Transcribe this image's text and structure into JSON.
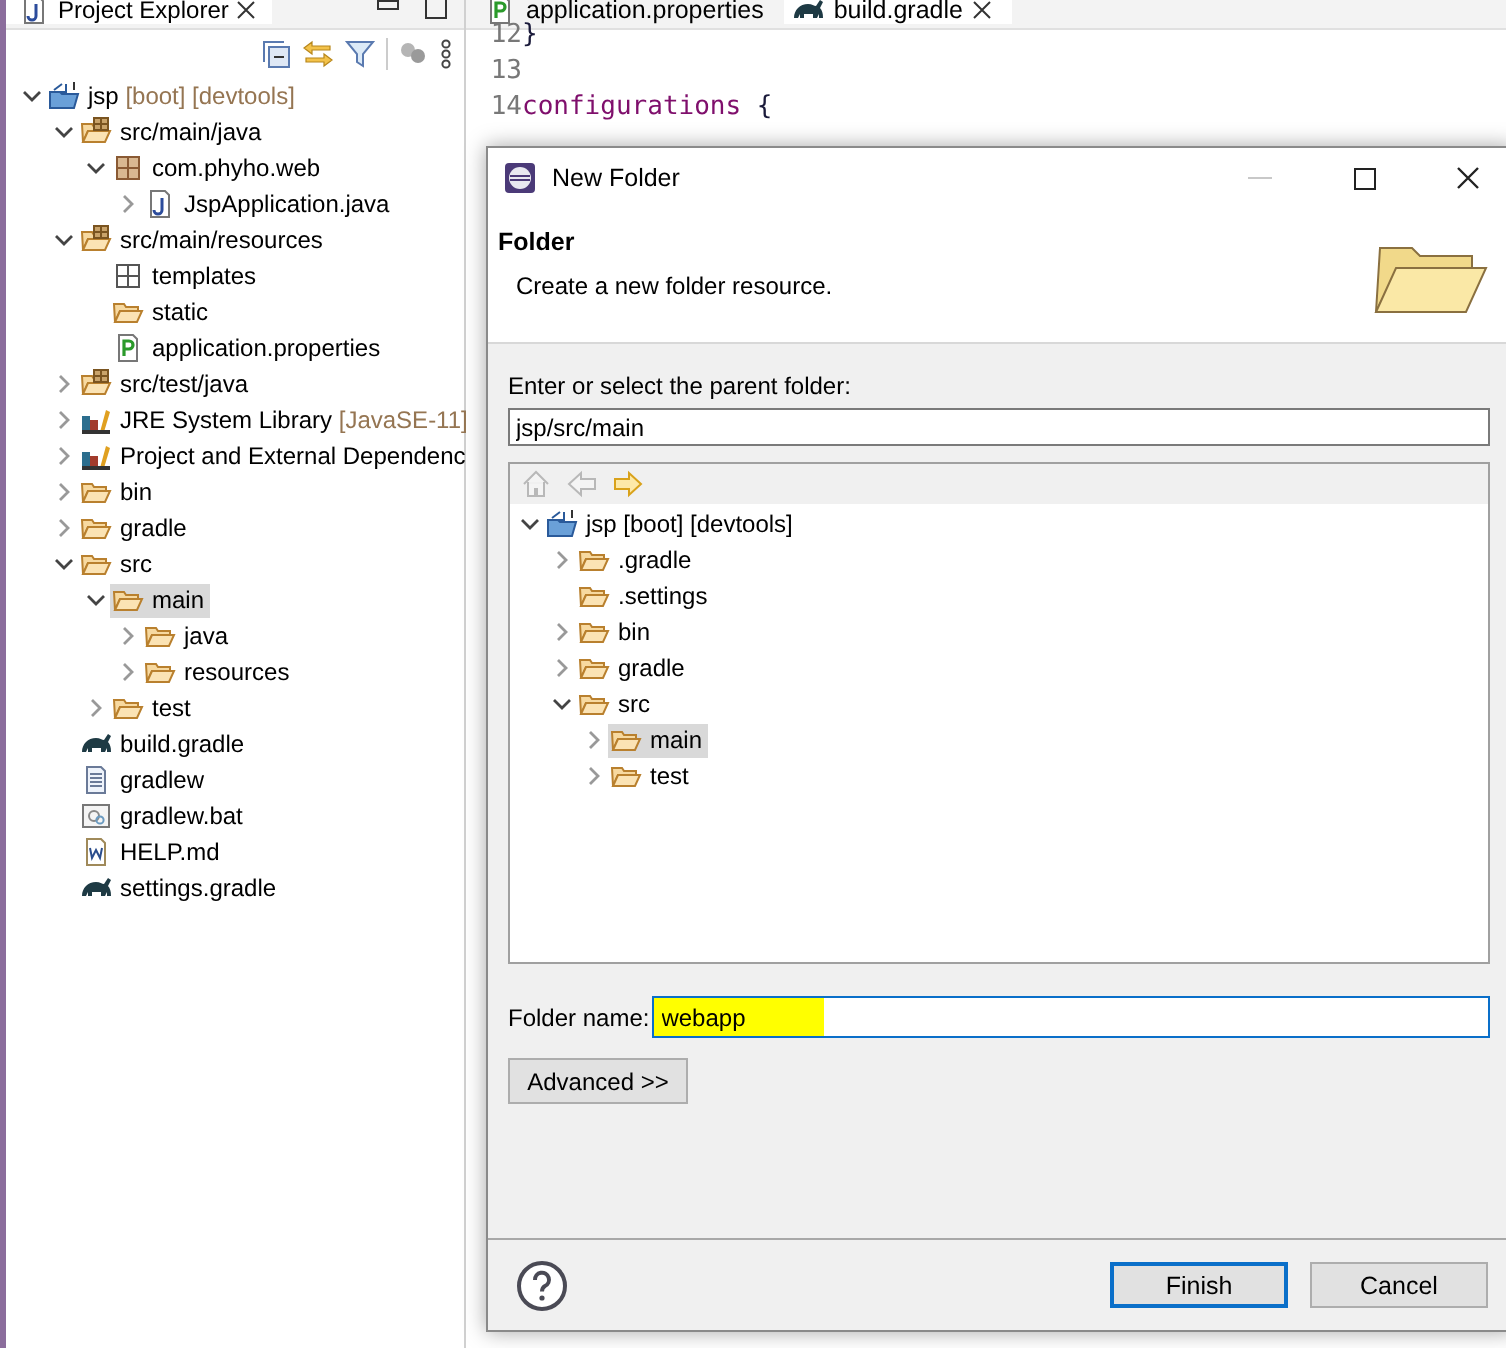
{
  "explorer": {
    "title": "Project Explorer",
    "tree": [
      {
        "label": "jsp",
        "decoration": "[boot] [devtools]",
        "kind": "project",
        "expanded": true,
        "selected": false,
        "children": [
          {
            "label": "src/main/java",
            "kind": "source-folder",
            "expanded": true,
            "selected": false,
            "children": [
              {
                "label": "com.phyho.web",
                "kind": "package",
                "expanded": true,
                "selected": false,
                "children": [
                  {
                    "label": "JspApplication.java",
                    "kind": "java-file",
                    "expanded": false,
                    "selected": false
                  }
                ]
              }
            ]
          },
          {
            "label": "src/main/resources",
            "kind": "source-folder",
            "expanded": true,
            "selected": false,
            "children": [
              {
                "label": "templates",
                "kind": "package-plain",
                "selected": false
              },
              {
                "label": "static",
                "kind": "folder",
                "selected": false
              },
              {
                "label": "application.properties",
                "kind": "properties",
                "selected": false
              }
            ]
          },
          {
            "label": "src/test/java",
            "kind": "source-folder",
            "expanded": false,
            "selected": false
          },
          {
            "label": "JRE System Library",
            "decoration": "[JavaSE-11]",
            "kind": "library",
            "expanded": false,
            "selected": false
          },
          {
            "label": "Project and External Dependenc",
            "kind": "library",
            "expanded": false,
            "selected": false
          },
          {
            "label": "bin",
            "kind": "folder",
            "expanded": false,
            "selected": false
          },
          {
            "label": "gradle",
            "kind": "folder",
            "expanded": false,
            "selected": false
          },
          {
            "label": "src",
            "kind": "folder",
            "expanded": true,
            "selected": false,
            "children": [
              {
                "label": "main",
                "kind": "folder",
                "expanded": true,
                "selected": true,
                "children": [
                  {
                    "label": "java",
                    "kind": "folder",
                    "expanded": false,
                    "selected": false
                  },
                  {
                    "label": "resources",
                    "kind": "folder",
                    "expanded": false,
                    "selected": false
                  }
                ]
              },
              {
                "label": "test",
                "kind": "folder",
                "expanded": false,
                "selected": false
              }
            ]
          },
          {
            "label": "build.gradle",
            "kind": "gradle",
            "selected": false
          },
          {
            "label": "gradlew",
            "kind": "text-file",
            "selected": false
          },
          {
            "label": "gradlew.bat",
            "kind": "bat-file",
            "selected": false
          },
          {
            "label": "HELP.md",
            "kind": "word-file",
            "selected": false
          },
          {
            "label": "settings.gradle",
            "kind": "gradle",
            "selected": false
          }
        ]
      }
    ]
  },
  "editor": {
    "tabs": [
      {
        "label": "application.properties",
        "kind": "properties",
        "selected": false
      },
      {
        "label": "build.gradle",
        "kind": "gradle",
        "selected": true
      }
    ],
    "lines": [
      {
        "number": "12",
        "tokens": [
          {
            "text": "}",
            "kind": "plain"
          }
        ]
      },
      {
        "number": "13"
      },
      {
        "number": "14",
        "tokens": [
          {
            "text": "configurations",
            "kind": "keyword"
          },
          {
            "text": " {",
            "kind": "plain"
          }
        ]
      }
    ]
  },
  "dialog": {
    "title": "New Folder",
    "header": {
      "title": "Folder",
      "description": "Create a new folder resource."
    },
    "parent_label": "Enter or select the parent folder:",
    "parent_value": "jsp/src/main",
    "nav": [
      {
        "kind": "home",
        "disabled": true
      },
      {
        "kind": "back",
        "disabled": true
      },
      {
        "kind": "forward",
        "disabled": false
      }
    ],
    "tree": [
      {
        "label": "jsp [boot] [devtools]",
        "kind": "project",
        "expanded": true,
        "selected": false,
        "children": [
          {
            "label": ".gradle",
            "kind": "folder",
            "expanded": false,
            "selected": false
          },
          {
            "label": ".settings",
            "kind": "folder",
            "selected": false
          },
          {
            "label": "bin",
            "kind": "folder",
            "expanded": false,
            "selected": false
          },
          {
            "label": "gradle",
            "kind": "folder",
            "expanded": false,
            "selected": false
          },
          {
            "label": "src",
            "kind": "folder",
            "expanded": true,
            "selected": false,
            "children": [
              {
                "label": "main",
                "kind": "folder",
                "expanded": false,
                "selected": true
              },
              {
                "label": "test",
                "kind": "folder",
                "expanded": false,
                "selected": false
              }
            ]
          }
        ]
      }
    ],
    "name_label": "Folder name:",
    "name_value": "webapp",
    "name_highlighted": true,
    "advanced": "Advanced >>",
    "buttons": [
      {
        "label": "Finish",
        "default": true
      },
      {
        "label": "Cancel",
        "default": false
      }
    ]
  }
}
